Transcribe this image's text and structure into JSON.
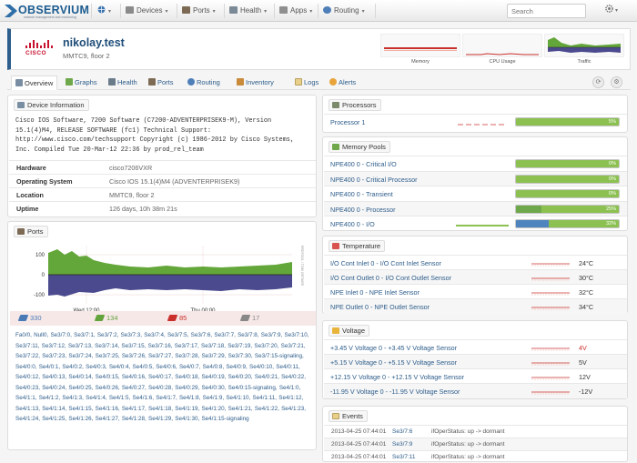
{
  "nav": {
    "brand": "OBSERVIUM",
    "brand_tagline": "network management and monitoring",
    "menu": [
      "Devices",
      "Ports",
      "Health",
      "Apps",
      "Routing"
    ],
    "search_placeholder": "Search"
  },
  "device": {
    "hostname": "nikolay.test",
    "location": "MMTC9, floor 2",
    "vendor_logo": "cisco",
    "vendor_logo_text": "CISCO",
    "graph_labels": [
      "Memory",
      "CPU Usage",
      "Traffic"
    ]
  },
  "tabs": [
    "Overview",
    "Graphs",
    "Health",
    "Ports",
    "Routing",
    "Inventory",
    "Logs",
    "Alerts"
  ],
  "device_info": {
    "title": "Device Information",
    "description": "Cisco IOS Software, 7200 Software (C7200-ADVENTERPRISEK9-M), Version 15.1(4)M4, RELEASE SOFTWARE (fc1) Technical Support: http://www.cisco.com/techsupport Copyright (c) 1986-2012 by Cisco Systems, Inc. Compiled Tue 20-Mar-12 22:36 by prod_rel_team",
    "rows": [
      {
        "key": "Hardware",
        "value": "cisco7206VXR"
      },
      {
        "key": "Operating System",
        "value": "Cisco IOS 15.1(4)M4 (ADVENTERPRISEK9)"
      },
      {
        "key": "Location",
        "value": "MMTC9, floor 2"
      },
      {
        "key": "Uptime",
        "value": "126 days, 10h 38m 21s"
      }
    ]
  },
  "ports": {
    "title": "Ports",
    "graph": {
      "y_ticks": [
        "100",
        "0",
        "-100"
      ],
      "x_ticks": [
        "Wed 12:00",
        "Thu 00:00"
      ],
      "side_label": "RRDTOOL / TOBI OETIKER"
    },
    "counts": [
      {
        "icon": "ports-total-icon",
        "value": "330",
        "color": "#4a7ab5"
      },
      {
        "icon": "ports-up-icon",
        "value": "134",
        "color": "#62a33c"
      },
      {
        "icon": "ports-down-icon",
        "value": "85",
        "color": "#c9302c"
      },
      {
        "icon": "ports-disabled-icon",
        "value": "17",
        "color": "#888888"
      }
    ],
    "list": "Fa0/0, Null0, Se3/7:0, Se3/7:1, Se3/7:2, Se3/7:3, Se3/7:4, Se3/7:5, Se3/7:6, Se3/7:7, Se3/7:8, Se3/7:9, Se3/7:10, Se3/7:11, Se3/7:12, Se3/7:13, Se3/7:14, Se3/7:15, Se3/7:16, Se3/7:17, Se3/7:18, Se3/7:19, Se3/7:20, Se3/7:21, Se3/7:22, Se3/7:23, Se3/7:24, Se3/7:25, Se3/7:26, Se3/7:27, Se3/7:28, Se3/7:29, Se3/7:30, Se3/7:15-signaling, Se4/0:0, Se4/0:1, Se4/0:2, Se4/0:3, Se4/0:4, Se4/0:5, Se4/0:6, Se4/0:7, Se4/0:8, Se4/0:9, Se4/0:10, Se4/0:11, Se4/0:12, Se4/0:13, Se4/0:14, Se4/0:15, Se4/0:16, Se4/0:17, Se4/0:18, Se4/0:19, Se4/0:20, Se4/0:21, Se4/0:22, Se4/0:23, Se4/0:24, Se4/0:25, Se4/0:26, Se4/0:27, Se4/0:28, Se4/0:29, Se4/0:30, Se4/0:15-signaling, Se4/1:0, Se4/1:1, Se4/1:2, Se4/1:3, Se4/1:4, Se4/1:5, Se4/1:6, Se4/1:7, Se4/1:8, Se4/1:9, Se4/1:10, Se4/1:11, Se4/1:12, Se4/1:13, Se4/1:14, Se4/1:15, Se4/1:16, Se4/1:17, Se4/1:18, Se4/1:19, Se4/1:20, Se4/1:21, Se4/1:22, Se4/1:23, Se4/1:24, Se4/1:25, Se4/1:26, Se4/1:27, Se4/1:28, Se4/1:29, Se4/1:30, Se4/1:15-signaling"
  },
  "processors": {
    "title": "Processors",
    "rows": [
      {
        "name": "Processor 1",
        "percent": 5,
        "label": "5%"
      }
    ]
  },
  "memory": {
    "title": "Memory Pools",
    "rows": [
      {
        "name": "NPE400 0 - Critical I/O",
        "percent": 0,
        "label": "0%",
        "color": "#8cc152"
      },
      {
        "name": "NPE400 0 - Critical Processor",
        "percent": 0,
        "label": "0%",
        "color": "#8cc152"
      },
      {
        "name": "NPE400 0 - Transient",
        "percent": 0,
        "label": "0%",
        "color": "#8cc152"
      },
      {
        "name": "NPE400 0 - Processor",
        "percent": 25,
        "label": "25%",
        "color": "#6ea84a"
      },
      {
        "name": "NPE400 0 - I/O",
        "percent": 32,
        "label": "32%",
        "color": "#4f85bf"
      }
    ]
  },
  "temperature": {
    "title": "Temperature",
    "rows": [
      {
        "name": "I/O Cont Inlet 0 - I/O Cont Inlet Sensor",
        "value": "24°C"
      },
      {
        "name": "I/O Cont Outlet 0 - I/O Cont Outlet Sensor",
        "value": "30°C"
      },
      {
        "name": "NPE Inlet 0 - NPE Inlet Sensor",
        "value": "32°C"
      },
      {
        "name": "NPE Outlet 0 - NPE Outlet Sensor",
        "value": "34°C"
      }
    ]
  },
  "voltage": {
    "title": "Voltage",
    "rows": [
      {
        "name": "+3.45 V Voltage 0 - +3.45 V Voltage Sensor",
        "value": "4V",
        "alert": true
      },
      {
        "name": "+5.15 V Voltage 0 - +5.15 V Voltage Sensor",
        "value": "5V",
        "alert": false
      },
      {
        "name": "+12.15 V Voltage 0 - +12.15 V Voltage Sensor",
        "value": "12V",
        "alert": false
      },
      {
        "name": "-11.95 V Voltage 0 - -11.95 V Voltage Sensor",
        "value": "-12V",
        "alert": false
      }
    ]
  },
  "events": {
    "title": "Events",
    "rows": [
      {
        "time": "2013-04-25 07:44:01",
        "port": "Se3/7:6",
        "message": "ifOperStatus: up -> dormant"
      },
      {
        "time": "2013-04-25 07:44:01",
        "port": "Se3/7:9",
        "message": "ifOperStatus: up -> dormant"
      },
      {
        "time": "2013-04-25 07:44:01",
        "port": "Se3/7:11",
        "message": "ifOperStatus: up -> dormant"
      }
    ]
  }
}
